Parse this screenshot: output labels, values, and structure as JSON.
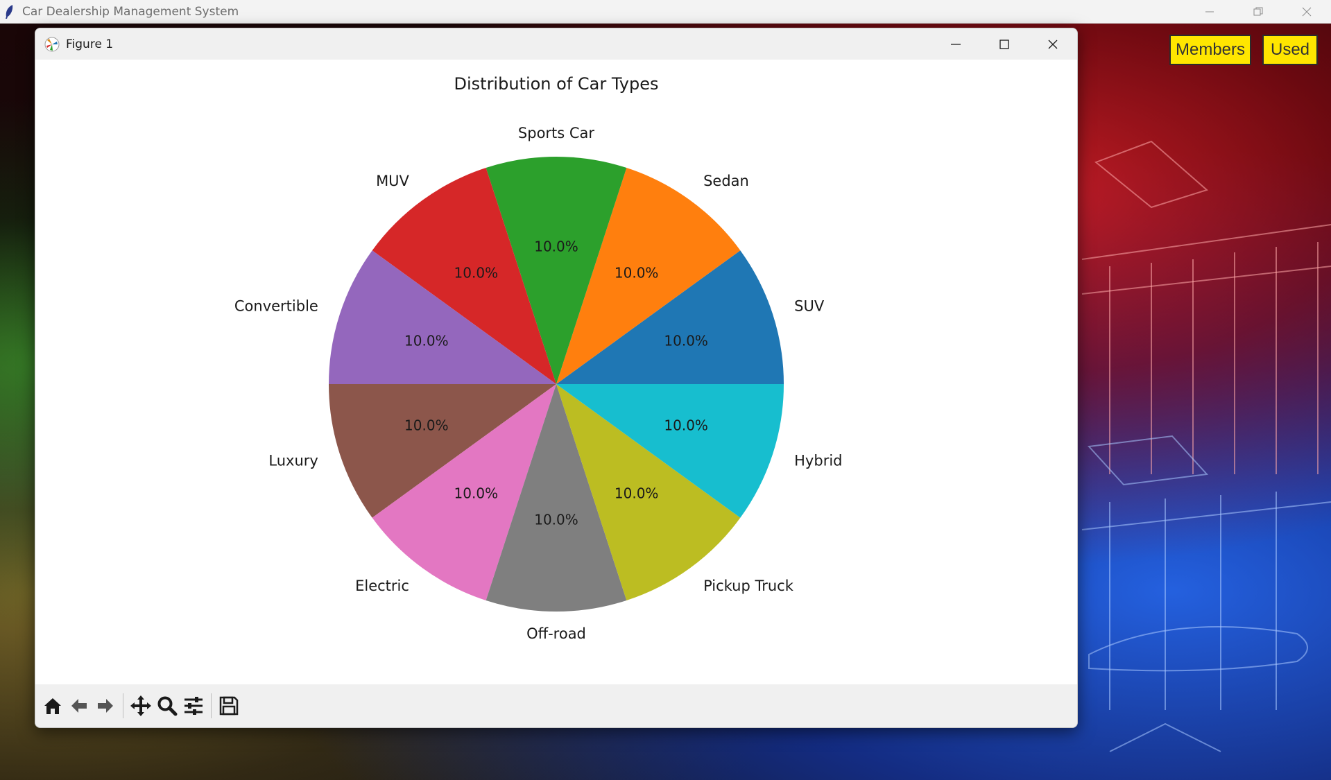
{
  "app": {
    "title": "Car Dealership Management System",
    "buttons": {
      "members": "Members",
      "used": "Used"
    },
    "accent": "#ffe600"
  },
  "figure_window": {
    "title": "Figure 1",
    "controls": [
      "minimize-icon",
      "maximize-icon",
      "close-icon"
    ],
    "toolbar": [
      "home-icon",
      "back-icon",
      "forward-icon",
      "pan-icon",
      "zoom-icon",
      "configure-subplots-icon",
      "save-icon"
    ]
  },
  "chart_data": {
    "type": "pie",
    "title": "Distribution of Car Types",
    "start_angle_deg": 0,
    "direction": "counterclockwise",
    "slices": [
      {
        "label": "SUV",
        "value": 10,
        "pct_label": "10.0%",
        "color": "#1f77b4"
      },
      {
        "label": "Sedan",
        "value": 10,
        "pct_label": "10.0%",
        "color": "#ff7f0e"
      },
      {
        "label": "Sports Car",
        "value": 10,
        "pct_label": "10.0%",
        "color": "#2ca02c"
      },
      {
        "label": "MUV",
        "value": 10,
        "pct_label": "10.0%",
        "color": "#d62728"
      },
      {
        "label": "Convertible",
        "value": 10,
        "pct_label": "10.0%",
        "color": "#9467bd"
      },
      {
        "label": "Luxury",
        "value": 10,
        "pct_label": "10.0%",
        "color": "#8c564b"
      },
      {
        "label": "Electric",
        "value": 10,
        "pct_label": "10.0%",
        "color": "#e377c2"
      },
      {
        "label": "Off-road",
        "value": 10,
        "pct_label": "10.0%",
        "color": "#7f7f7f"
      },
      {
        "label": "Pickup Truck",
        "value": 10,
        "pct_label": "10.0%",
        "color": "#bcbd22"
      },
      {
        "label": "Hybrid",
        "value": 10,
        "pct_label": "10.0%",
        "color": "#17becf"
      }
    ]
  }
}
